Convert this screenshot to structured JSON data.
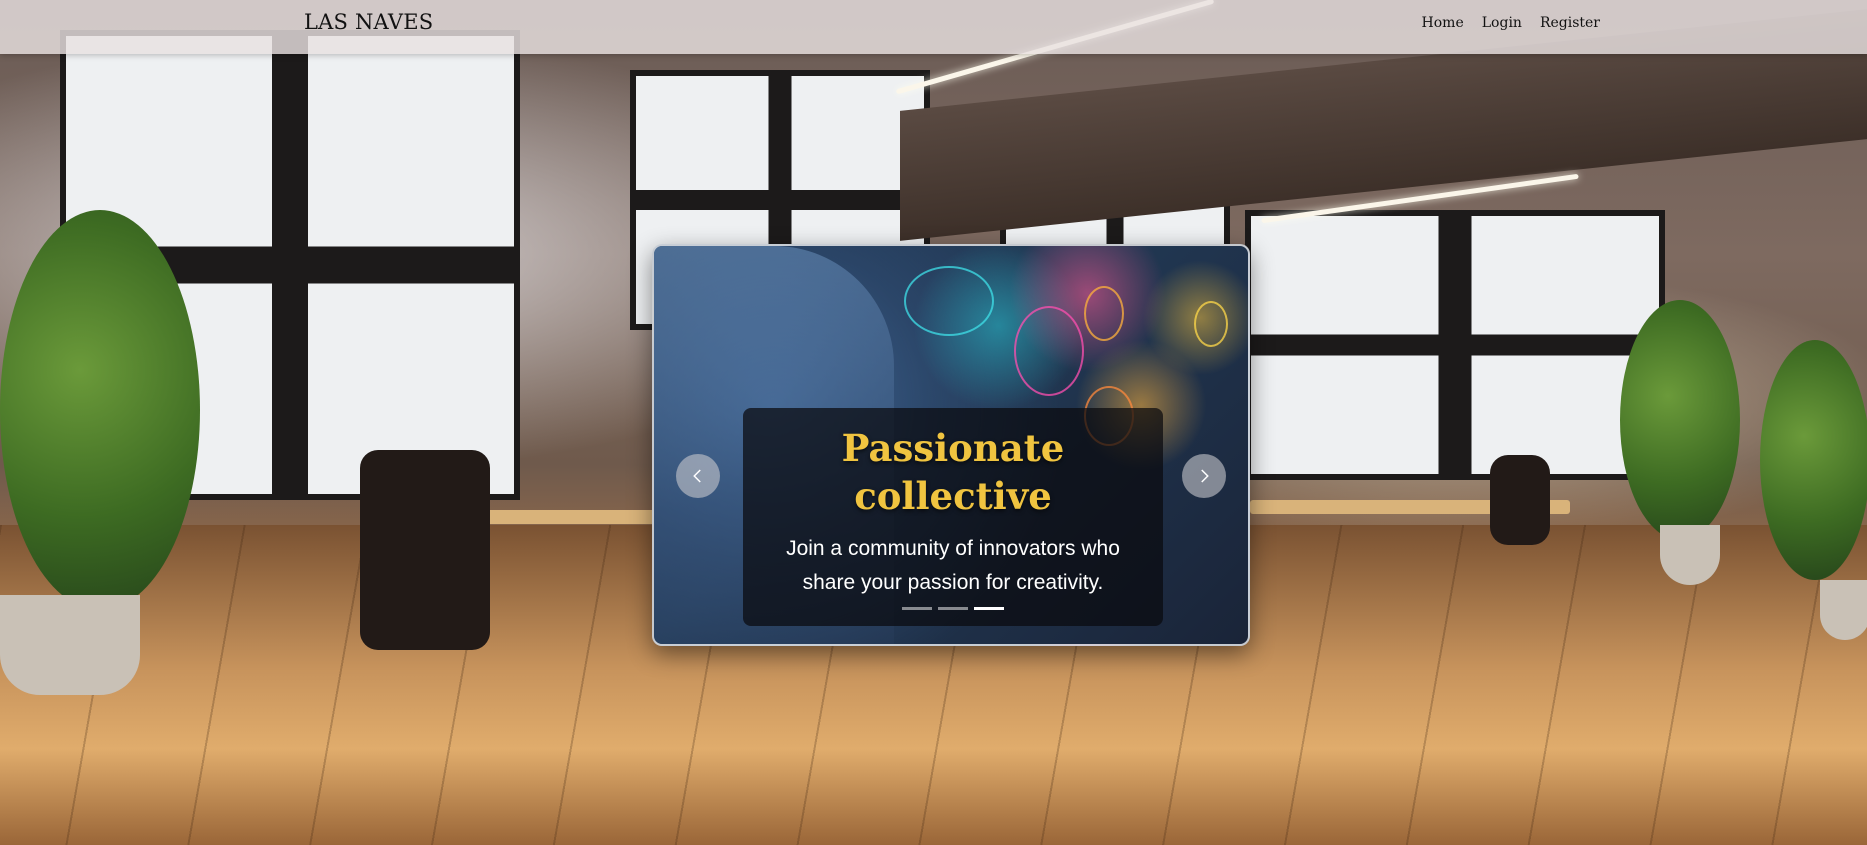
{
  "navbar": {
    "brand": "LAS NAVES",
    "links": [
      "Home",
      "Login",
      "Register"
    ]
  },
  "carousel": {
    "title": "Passionate collective",
    "text": "Join a community of innovators who share your passion for creativity.",
    "prev_icon": "chevron-left-icon",
    "next_icon": "chevron-right-icon",
    "indicators": 3,
    "active_indicator": 3
  },
  "colors": {
    "title": "#f0c440",
    "caption_bg": "#0a0a0e",
    "navbar_bg": "#e8e0e1"
  }
}
